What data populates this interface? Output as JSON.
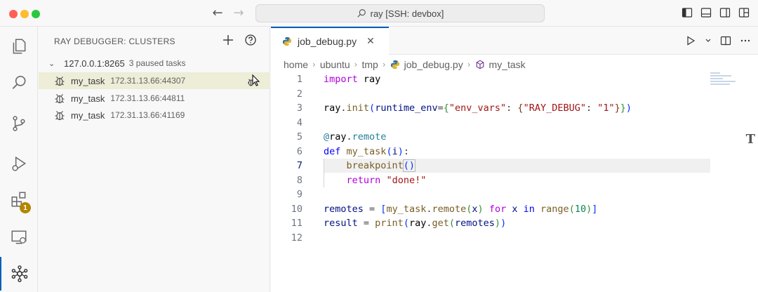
{
  "window": {
    "command_center": "ray [SSH: devbox]"
  },
  "activity_bar": {
    "items": [
      {
        "icon": "files-icon"
      },
      {
        "icon": "search-icon"
      },
      {
        "icon": "source-control-icon"
      },
      {
        "icon": "run-debug-icon"
      },
      {
        "icon": "extensions-icon",
        "badge": "1"
      },
      {
        "icon": "remote-explorer-icon"
      },
      {
        "icon": "ray-debugger-icon",
        "active": true
      }
    ]
  },
  "sidebar": {
    "title": "RAY DEBUGGER: CLUSTERS",
    "cluster": {
      "address": "127.0.0.1:8265",
      "description": "3 paused tasks"
    },
    "tasks": [
      {
        "name": "my_task",
        "address": "172.31.13.66:44307",
        "selected": true
      },
      {
        "name": "my_task",
        "address": "172.31.13.66:44811"
      },
      {
        "name": "my_task",
        "address": "172.31.13.66:41169"
      }
    ]
  },
  "editor": {
    "tab": {
      "label": "job_debug.py"
    },
    "breadcrumb": [
      "home",
      "ubuntu",
      "tmp",
      "job_debug.py",
      "my_task"
    ],
    "current_line": 7,
    "lines": [
      {
        "n": "1"
      },
      {
        "n": "2"
      },
      {
        "n": "3"
      },
      {
        "n": "4"
      },
      {
        "n": "5"
      },
      {
        "n": "6"
      },
      {
        "n": "7"
      },
      {
        "n": "8"
      },
      {
        "n": "9"
      },
      {
        "n": "10"
      },
      {
        "n": "11"
      },
      {
        "n": "12"
      }
    ],
    "code": {
      "l1_import": "import",
      "l1_mod": "ray",
      "l3_ray": "ray",
      "l3_init": "init",
      "l3_kw": "runtime_env",
      "l3_key": "\"env_vars\"",
      "l3_k2": "\"RAY_DEBUG\"",
      "l3_v2": "\"1\"",
      "l5_at": "@",
      "l5_ray": "ray",
      "l5_remote": "remote",
      "l6_def": "def",
      "l6_fn": "my_task",
      "l6_arg": "i",
      "l7_call": "breakpoint",
      "l8_return": "return",
      "l8_str": "\"done!\"",
      "l10_var": "remotes",
      "l10_fn": "my_task",
      "l10_remote": "remote",
      "l10_x": "x",
      "l10_for": "for",
      "l10_x2": "x",
      "l10_in": "in",
      "l10_range": "range",
      "l10_num": "10",
      "l11_var": "result",
      "l11_print": "print",
      "l11_ray": "ray",
      "l11_get": "get",
      "l11_arg": "remotes"
    }
  },
  "colors": {
    "accent": "#005fb8",
    "badge": "#b38600",
    "selection": "#ededd8"
  }
}
